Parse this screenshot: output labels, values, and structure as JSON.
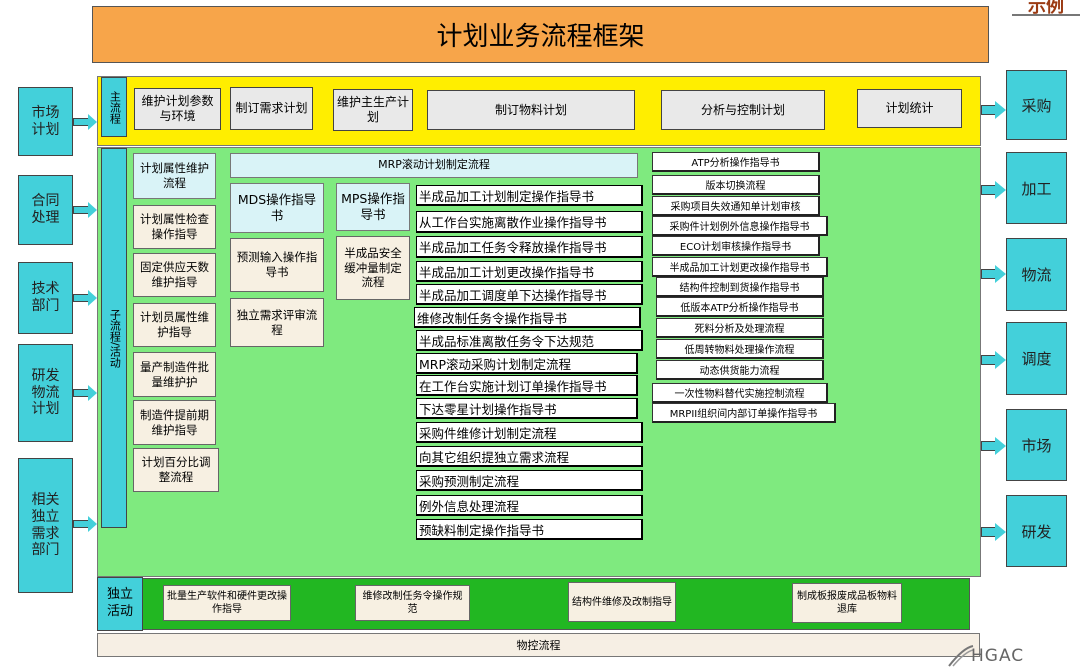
{
  "title": "计划业务流程框架",
  "sample_label": "示例",
  "main_flow": {
    "label": "主流程",
    "items": [
      "维护计划参数与环境",
      "制订需求计划",
      "维护主生产计划",
      "制订物料计划",
      "分析与控制计划",
      "计划统计"
    ]
  },
  "sub_flow": {
    "label": "子流程/活动",
    "col1": [
      "计划属性维护流程",
      "计划属性检查操作指导",
      "固定供应天数维护指导",
      "计划员属性维护指导",
      "量产制造件批量维护护",
      "制造件提前期维护指导",
      "计划百分比调整流程"
    ],
    "mrp_header": "MRP滚动计划制定流程",
    "mds": "MDS操作指导书",
    "mps": "MPS操作指导书",
    "forecast_input": "预测输入操作指导书",
    "independent_review": "独立需求评审流程",
    "safety_stock": "半成品安全缓冲量制定流程",
    "list1": [
      "半成品加工计划制定操作指导书",
      "从工作台实施离散作业操作指导书",
      "半成品加工任务令释放操作指导书",
      "半成品加工计划更改操作指导书",
      "半成品加工调度单下达操作指导书",
      "维修改制任务令操作指导书",
      "半成品标准离散任务令下达规范",
      "MRP滚动采购计划制定流程",
      "在工作台实施计划订单操作指导书",
      "下达零星计划操作指导书",
      "采购件维修计划制定流程",
      "向其它组织提独立需求流程",
      "采购预测制定流程",
      "例外信息处理流程",
      "预缺料制定操作指导书"
    ],
    "list2": [
      "ATP分析操作指导书",
      "版本切换流程",
      "采购项目失效通知单计划审核",
      "采购件计划例外信息操作指导书",
      "ECO计划审核操作指导书",
      "半成品加工计划更改操作指导书",
      "结构件控制到货操作指导书",
      "低版本ATP分析操作指导书",
      "死料分析及处理流程",
      "低周转物料处理操作流程",
      "动态供货能力流程",
      "一次性物料替代实施控制流程",
      "MRPII组织间内部订单操作指导书"
    ]
  },
  "independent": {
    "label": "独立活动",
    "items": [
      "批量生产软件和硬件更改操作指导",
      "维修改制任务令操作规范",
      "结构件维修及改制指导",
      "制成板报废成品板物料退库"
    ]
  },
  "bottom_flow": "物控流程",
  "inputs": [
    "市场计划",
    "合同处理",
    "技术部门",
    "研发物流计划",
    "相关独立需求部门"
  ],
  "outputs": [
    "采购",
    "加工",
    "物流",
    "调度",
    "市场",
    "研发"
  ],
  "logo": "HGAC",
  "colors": {
    "title_bg": "#f7a54a",
    "main_band": "#ffee00",
    "sub_band": "#7fea7f",
    "independent_band": "#22b722",
    "side_boxes": "#43d0da"
  }
}
